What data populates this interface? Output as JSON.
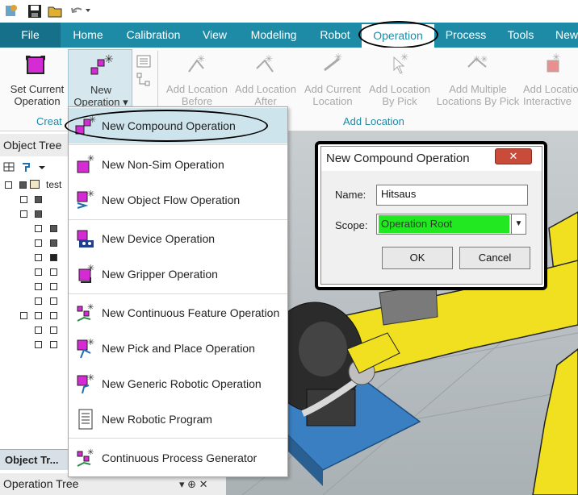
{
  "menubar": {
    "tabs": [
      "File",
      "Home",
      "Calibration",
      "View",
      "Modeling",
      "Robot",
      "Operation",
      "Process",
      "Tools",
      "New"
    ]
  },
  "ribbon": {
    "set_current_operation": [
      "Set Current",
      "Operation"
    ],
    "new_operation": [
      "New",
      "Operation"
    ],
    "dropdown_arrow": "▾",
    "add_location_before": [
      "Add Location",
      "Before"
    ],
    "add_location_after": [
      "Add Location",
      "After"
    ],
    "add_current_location": [
      "Add Current",
      "Location"
    ],
    "add_location_by_pick": [
      "Add Location",
      "By Pick"
    ],
    "add_multiple_locations_by_pick": [
      "Add Multiple",
      "Locations By Pick"
    ],
    "add_location_interactive": [
      "Add Locatio",
      "Interactive"
    ],
    "group_create": "Creat",
    "group_add_location": "Add Location"
  },
  "object_tree": {
    "title": "Object Tree",
    "root_label": "test",
    "bottom_tab": "Object Tr...",
    "operation_tree_title": "Operation Tree",
    "pane_controls": "▾ ⊕ ✕"
  },
  "new_operation_menu": {
    "items": [
      "New Compound Operation",
      "New Non-Sim Operation",
      "New Object Flow Operation",
      "New Device Operation",
      "New Gripper Operation",
      "New Continuous Feature Operation",
      "New Pick and Place Operation",
      "New Generic Robotic Operation",
      "New Robotic Program",
      "Continuous Process Generator"
    ]
  },
  "dialog": {
    "title": "New Compound Operation",
    "close_label": "✕",
    "name_label": "Name:",
    "name_value": "Hitsaus",
    "scope_label": "Scope:",
    "scope_value": "Operation Root",
    "ok_label": "OK",
    "cancel_label": "Cancel"
  },
  "colors": {
    "menubar": "#1e8ba6",
    "accent_magenta": "#cc22cc",
    "scope_highlight": "#22e822",
    "robot_yellow": "#f0e020"
  }
}
